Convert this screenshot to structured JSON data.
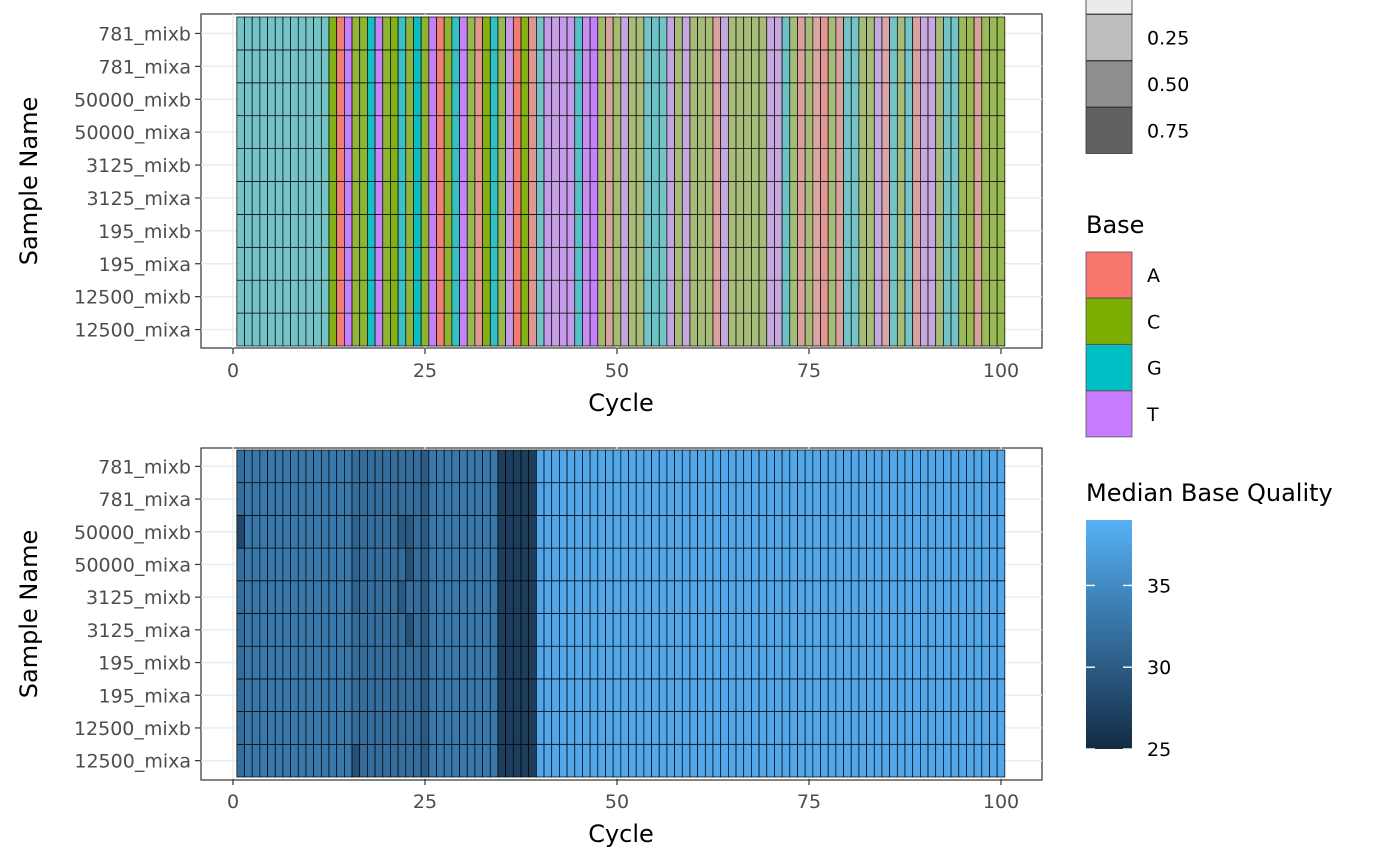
{
  "chart_data": [
    {
      "type": "heatmap",
      "title": "",
      "xlabel": "Cycle",
      "ylabel": "Sample Name",
      "xlim": [
        0,
        100
      ],
      "x_ticks": [
        0,
        25,
        50,
        75,
        100
      ],
      "samples": [
        "12500_mixa",
        "12500_mixb",
        "195_mixa",
        "195_mixb",
        "3125_mixa",
        "3125_mixb",
        "50000_mixa",
        "50000_mixb",
        "781_mixa",
        "781_mixb"
      ],
      "cycles": 100,
      "fill_legend": {
        "title": "Base",
        "entries": [
          {
            "label": "A",
            "color": "#F8766D"
          },
          {
            "label": "C",
            "color": "#7CAE00"
          },
          {
            "label": "G",
            "color": "#00BFC4"
          },
          {
            "label": "T",
            "color": "#C77CFF"
          }
        ]
      },
      "alpha_legend": {
        "title": "",
        "entries": [
          {
            "label": "",
            "color": "#EBEBEB"
          },
          {
            "label": "0.25",
            "color": "#BEBEBE"
          },
          {
            "label": "0.50",
            "color": "#8E8E8E"
          },
          {
            "label": "0.75",
            "color": "#616161"
          }
        ]
      },
      "dominant_base_by_cycle": [
        "G",
        "G",
        "G",
        "G",
        "G",
        "G",
        "G",
        "G",
        "G",
        "G",
        "G",
        "G",
        "C",
        "A",
        "T",
        "C",
        "C",
        "G",
        "T",
        "C",
        "C",
        "G",
        "C",
        "G",
        "C",
        "T",
        "A",
        "C",
        "G",
        "T",
        "C",
        "A",
        "C",
        "G",
        "C",
        "T",
        "A",
        "C",
        "A",
        "G",
        "T",
        "T",
        "T",
        "T",
        "G",
        "T",
        "T",
        "C",
        "A",
        "C",
        "T",
        "C",
        "C",
        "G",
        "G",
        "G",
        "T",
        "C",
        "T",
        "C",
        "C",
        "C",
        "A",
        "T",
        "C",
        "C",
        "C",
        "C",
        "C",
        "T",
        "T",
        "G",
        "C",
        "A",
        "C",
        "A",
        "A",
        "C",
        "A",
        "G",
        "G",
        "C",
        "C",
        "T",
        "A",
        "G",
        "C",
        "G",
        "A",
        "T",
        "T",
        "C",
        "G",
        "G",
        "C",
        "C",
        "A",
        "C",
        "C",
        "C"
      ],
      "dominant_base_intensity_by_cycle": [
        0.4,
        0.4,
        0.4,
        0.4,
        0.4,
        0.4,
        0.4,
        0.4,
        0.4,
        0.4,
        0.4,
        0.4,
        0.9,
        0.9,
        0.95,
        0.7,
        0.75,
        0.9,
        0.9,
        0.75,
        0.9,
        0.7,
        0.7,
        0.95,
        0.75,
        0.95,
        0.9,
        0.75,
        0.75,
        0.9,
        0.6,
        0.6,
        0.9,
        0.75,
        0.6,
        0.6,
        0.95,
        0.9,
        0.6,
        0.4,
        0.6,
        0.5,
        0.6,
        0.6,
        0.55,
        0.75,
        0.95,
        0.45,
        0.45,
        0.45,
        0.45,
        0.4,
        0.4,
        0.4,
        0.45,
        0.4,
        0.45,
        0.4,
        0.4,
        0.4,
        0.4,
        0.4,
        0.45,
        0.4,
        0.4,
        0.4,
        0.4,
        0.4,
        0.4,
        0.4,
        0.4,
        0.45,
        0.4,
        0.45,
        0.4,
        0.4,
        0.6,
        0.4,
        0.45,
        0.4,
        0.4,
        0.4,
        0.4,
        0.4,
        0.4,
        0.4,
        0.4,
        0.4,
        0.45,
        0.4,
        0.4,
        0.4,
        0.4,
        0.4,
        0.55,
        0.6,
        0.45,
        0.55,
        0.55,
        0.6
      ]
    },
    {
      "type": "heatmap",
      "title": "",
      "xlabel": "Cycle",
      "ylabel": "Sample Name",
      "xlim": [
        0,
        100
      ],
      "x_ticks": [
        0,
        25,
        50,
        75,
        100
      ],
      "samples": [
        "12500_mixa",
        "12500_mixb",
        "195_mixa",
        "195_mixb",
        "3125_mixa",
        "3125_mixb",
        "50000_mixa",
        "50000_mixb",
        "781_mixa",
        "781_mixb"
      ],
      "cycles": 100,
      "colorbar": {
        "title": "Median Base Quality",
        "min": 25,
        "max": 39,
        "ticks": [
          25,
          30,
          35
        ],
        "low_color": "#132B43",
        "high_color": "#56B1F7"
      },
      "median_quality_by_cycle": [
        32,
        33,
        33,
        33,
        33,
        33,
        33,
        33,
        33,
        33,
        33,
        33,
        33,
        33,
        33,
        32,
        32,
        32,
        32,
        32,
        32,
        32,
        32,
        32,
        30,
        33,
        33,
        33,
        33,
        33,
        33,
        33,
        33,
        33,
        27,
        27,
        27,
        27,
        27,
        38,
        38,
        38,
        38,
        38,
        38,
        38,
        38,
        38,
        38,
        38,
        38,
        38,
        38,
        38,
        38,
        38,
        38,
        38,
        38,
        38,
        38,
        38,
        38,
        38,
        38,
        38,
        38,
        38,
        38,
        38,
        38,
        38,
        38,
        38,
        38,
        38,
        38,
        38,
        38,
        38,
        38,
        38,
        38,
        38,
        38,
        38,
        38,
        38,
        38,
        38,
        38,
        38,
        38,
        38,
        38,
        38,
        38,
        38,
        38,
        38
      ],
      "median_quality_overrides": [
        {
          "sample": "50000_mixb",
          "cycle": 1,
          "value": 28
        },
        {
          "sample": "12500_mixa",
          "cycle": 16,
          "value": 29
        },
        {
          "sample": "50000_mixb",
          "cycle": 16,
          "value": 31
        },
        {
          "sample": "50000_mixa",
          "cycle": 16,
          "value": 31
        },
        {
          "sample": "3125_mixb",
          "cycle": 16,
          "value": 31
        },
        {
          "sample": "50000_mixb",
          "cycle": 22,
          "value": 30
        },
        {
          "sample": "50000_mixb",
          "cycle": 23,
          "value": 30
        },
        {
          "sample": "50000_mixa",
          "cycle": 23,
          "value": 29
        },
        {
          "sample": "3125_mixb",
          "cycle": 22,
          "value": 30
        },
        {
          "sample": "3125_mixa",
          "cycle": 23,
          "value": 29
        }
      ]
    }
  ]
}
